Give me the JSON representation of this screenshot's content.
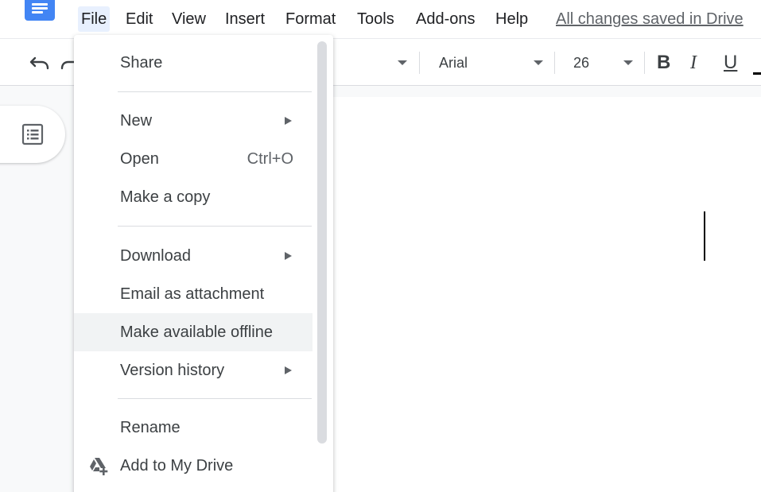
{
  "menubar": {
    "app_icon": "docs-logo-icon",
    "items": [
      "File",
      "Edit",
      "View",
      "Insert",
      "Format",
      "Tools",
      "Add-ons",
      "Help"
    ],
    "active_item": "File",
    "save_status": "All changes saved in Drive"
  },
  "toolbar": {
    "undo_icon": "undo-icon",
    "redo_icon": "redo-icon",
    "font": "Arial",
    "font_size": "26",
    "bold_label": "B",
    "italic_label": "I",
    "underline_label": "U",
    "accent_color": "#4285f4"
  },
  "sidebar": {
    "outline_icon": "document-outline-icon"
  },
  "file_menu": {
    "items": {
      "share": "Share",
      "new": "New",
      "open": "Open",
      "open_shortcut": "Ctrl+O",
      "make_copy": "Make a copy",
      "download": "Download",
      "email": "Email as attachment",
      "offline": "Make available offline",
      "version_history": "Version history",
      "rename": "Rename",
      "add_to_drive": "Add to My Drive"
    },
    "highlighted": "Make available offline",
    "add_to_drive_icon": "drive-add-icon"
  }
}
